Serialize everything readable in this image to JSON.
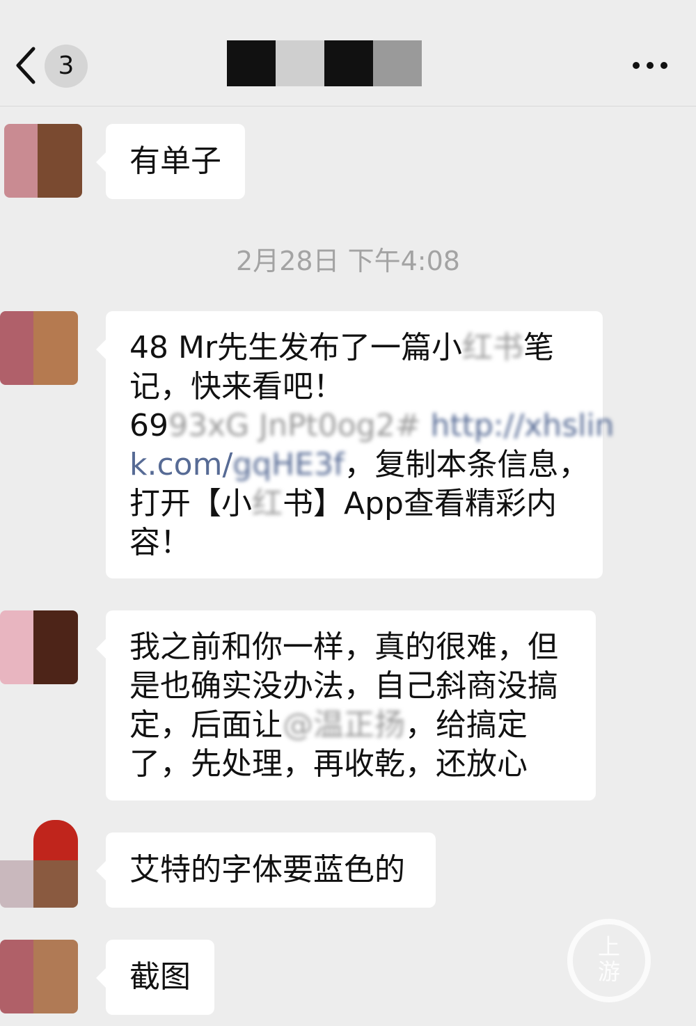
{
  "header": {
    "unread_count": "3",
    "back_icon": "chevron-left-icon",
    "more_icon": "more-dots-icon"
  },
  "messages": [
    {
      "text": "有单子",
      "avatar_colors": [
        "#c98b92",
        "#7a4a30"
      ]
    },
    {
      "parts": {
        "l1": "48 Mr先生发布了一篇小",
        "l1_blur": "红书",
        "l1_end": "笔",
        "l2": "记，快来看吧！",
        "l3": "69",
        "l3_blur": "93xG JnPt0og2#",
        "l3_link": "http://xhslin",
        "l4_link": "k.com/",
        "l4_blur": "gqHE3f",
        "l4_end": "，复制本条信息，",
        "l5": "打开【小",
        "l5_blur": "红",
        "l5_end": "书】App查看精彩内",
        "l6": "容！"
      },
      "avatar_colors": [
        "#b0606a",
        "#b57a50"
      ]
    },
    {
      "parts": {
        "l1": "我之前和你一样，真的很难，但",
        "l2": "是也确实没办法，自己斜商没搞",
        "l3": "定，后面让",
        "l3_blur": "@温正扬",
        "l3_end": "，给搞定",
        "l4": "了，先处理，再收乾，还放心"
      },
      "avatar_colors": [
        "#e8b5c0",
        "#4d2418"
      ]
    },
    {
      "text": "艾特的字体要蓝色的",
      "avatar_colors": [
        "#c0251c",
        "#8a5a40"
      ]
    },
    {
      "text": "截图",
      "avatar_colors": [
        "#b06068",
        "#b07a55"
      ]
    }
  ],
  "timestamp": "2月28日 下午4:08",
  "watermark": {
    "line1": "上",
    "line2": "游"
  }
}
